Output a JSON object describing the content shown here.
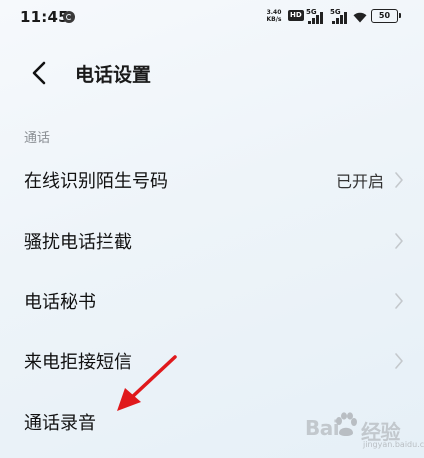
{
  "status_bar": {
    "time": "11:45",
    "net_speed": "3.40",
    "net_unit": "KB/s",
    "hd_badge": "HD",
    "sim1_label": "5G",
    "sim2_label": "5G",
    "battery": "50",
    "icons": [
      "notification-icon",
      "signal-icon",
      "wifi-icon",
      "battery-icon"
    ]
  },
  "header": {
    "title": "电话设置",
    "back_icon": "chevron-left-icon"
  },
  "section": {
    "label": "通话"
  },
  "rows": [
    {
      "label": "在线识别陌生号码",
      "value": "已开启",
      "has_chevron": true
    },
    {
      "label": "骚扰电话拦截",
      "value": "",
      "has_chevron": true
    },
    {
      "label": "电话秘书",
      "value": "",
      "has_chevron": true
    },
    {
      "label": "来电拒接短信",
      "value": "",
      "has_chevron": true
    },
    {
      "label": "通话录音",
      "value": "",
      "has_chevron": false
    }
  ],
  "annotation": {
    "color": "#e0191c",
    "points_to": "通话录音"
  },
  "watermark": {
    "left_text": "Bai",
    "right_text": "经验",
    "sub_text": "jingyan.baidu.com"
  },
  "colors": {
    "background": "#eef4f9",
    "text_primary": "#111111",
    "text_secondary": "#8b8f94",
    "chevron": "#c4c8cc"
  }
}
